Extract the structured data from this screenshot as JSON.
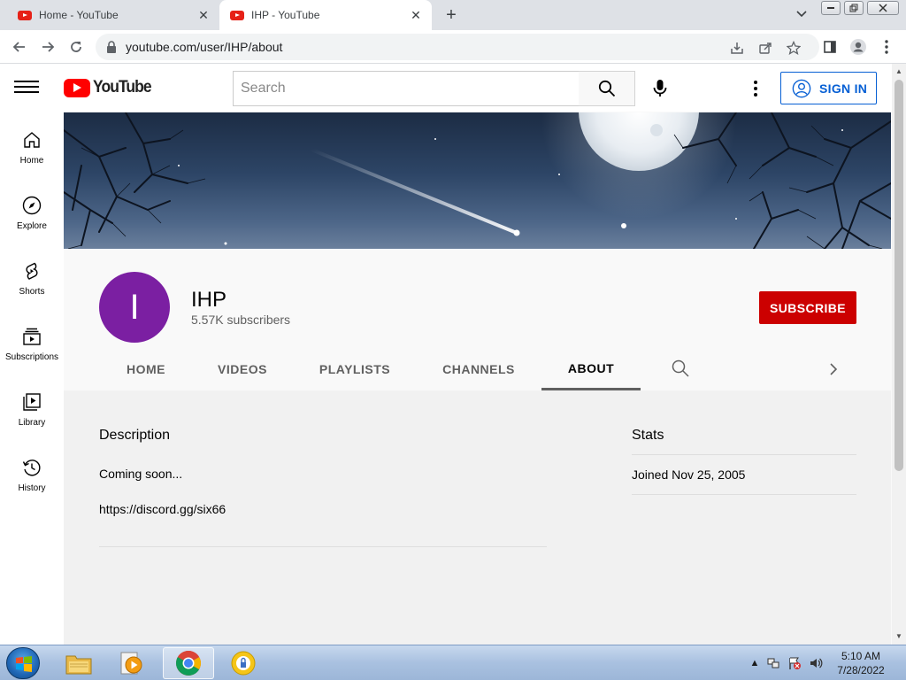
{
  "browser": {
    "tabs": [
      {
        "title": "Home - YouTube",
        "active": false
      },
      {
        "title": "IHP - YouTube",
        "active": true
      }
    ],
    "url": "youtube.com/user/IHP/about"
  },
  "masthead": {
    "logo_text": "YouTube",
    "search_placeholder": "Search",
    "signin_label": "SIGN IN"
  },
  "guide": {
    "items": [
      {
        "label": "Home",
        "icon": "home-icon"
      },
      {
        "label": "Explore",
        "icon": "compass-icon"
      },
      {
        "label": "Shorts",
        "icon": "shorts-icon"
      },
      {
        "label": "Subscriptions",
        "icon": "subscriptions-icon"
      },
      {
        "label": "Library",
        "icon": "library-icon"
      },
      {
        "label": "History",
        "icon": "history-icon"
      }
    ]
  },
  "channel": {
    "avatar_letter": "I",
    "avatar_color": "#7b1fa2",
    "name": "IHP",
    "subscribers": "5.57K subscribers",
    "subscribe_label": "SUBSCRIBE",
    "subscribe_color": "#cc0000",
    "tabs": [
      "HOME",
      "VIDEOS",
      "PLAYLISTS",
      "CHANNELS",
      "ABOUT"
    ],
    "active_tab": "ABOUT"
  },
  "about": {
    "description_heading": "Description",
    "description_lines": [
      "Coming soon...",
      "https://discord.gg/six66"
    ],
    "stats_heading": "Stats",
    "joined": "Joined Nov 25, 2005"
  },
  "taskbar": {
    "apps": [
      "file-explorer-icon",
      "media-player-icon",
      "chrome-icon",
      "security-app-icon"
    ],
    "active_app": "chrome-icon",
    "time": "5:10 AM",
    "date": "7/28/2022"
  }
}
